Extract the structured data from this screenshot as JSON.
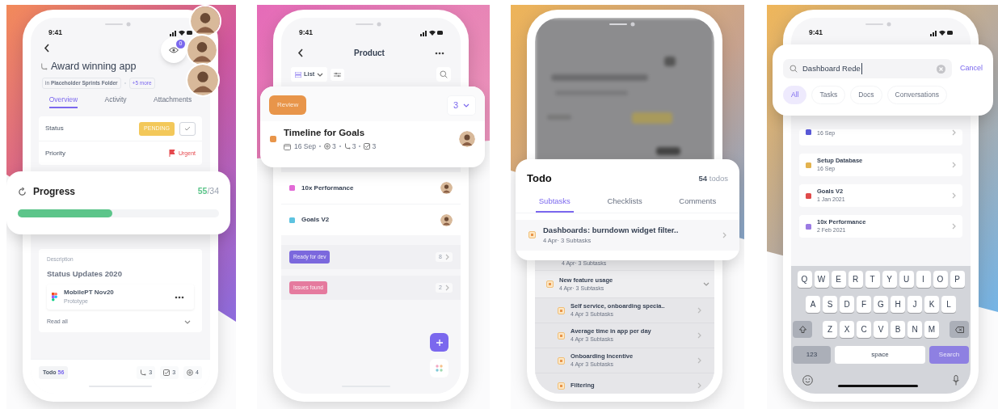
{
  "panels": [
    {
      "kind": "task_detail",
      "time": "9:41",
      "title": "Award winning app",
      "location": "in **Placeholder Sprints Folder**",
      "more": "+5 more",
      "watchers": "0",
      "tabs": [
        {
          "label": "Overview",
          "selected": true
        },
        {
          "label": "Activity",
          "selected": false
        },
        {
          "label": "Attachments",
          "selected": false
        }
      ],
      "fields": [
        {
          "kind": "status",
          "label": "Status",
          "value": "PENDING"
        },
        {
          "kind": "priority",
          "label": "Priority",
          "value": "Urgent"
        }
      ],
      "progress": {
        "title": "Progress",
        "done": "55",
        "total": "/34",
        "level": 0.47
      },
      "description": {
        "label": "Description",
        "title": "Status Updates 2020",
        "file": "MobilePT Nov20",
        "file_type": "Prototype",
        "link": "Read all"
      },
      "footer": {
        "status": "Todo",
        "count": "56",
        "counts": [
          {
            "kind": "subtasks",
            "value": "3"
          },
          {
            "kind": "checklists",
            "value": "3"
          },
          {
            "kind": "comments",
            "value": "4"
          }
        ]
      }
    },
    {
      "kind": "list",
      "time": "9:41",
      "title": "Product",
      "view": "List",
      "group": {
        "label": "Review",
        "count": "3",
        "color": "#e8954a"
      },
      "task": {
        "title": "Timeline for Goals",
        "color": "#e8954a",
        "date": "16 Sep",
        "meta": [
          {
            "kind": "comments",
            "value": "3"
          },
          {
            "kind": "subtasks",
            "value": "3"
          },
          {
            "kind": "checklists",
            "value": "3"
          }
        ]
      },
      "tasks": [
        {
          "title": "10x Performance",
          "color": "#e26ad6"
        },
        {
          "title": "Goals V2",
          "color": "#5ec3e0"
        }
      ],
      "groups": [
        {
          "label": "Ready for dev",
          "count": "8",
          "color": "#7b68dd"
        },
        {
          "label": "Issues found",
          "count": "2",
          "color": "#e57a9e"
        }
      ]
    },
    {
      "kind": "todo",
      "title": "Todo",
      "count": "54",
      "unit": "todos",
      "tabs": [
        {
          "label": "Subtasks",
          "selected": true
        },
        {
          "label": "Checklists",
          "selected": false
        },
        {
          "label": "Comments",
          "selected": false
        }
      ],
      "highlight": {
        "title": "Dashboards: burndown widget filter..",
        "subtitle": "4 Apr· 3 Subtasks"
      },
      "items": [
        {
          "subtitle": "4 Apr· 3 Subtasks"
        },
        {
          "title": "New feature usage",
          "subtitle": "4 Apr· 3 Subtasks",
          "expanded": true,
          "children": [
            {
              "title": "Self service, onboarding specia..",
              "subtitle": "4 Apr 3 Subtasks"
            },
            {
              "title": "Average time in app per day",
              "subtitle": "4 Apr 3 Subtasks"
            },
            {
              "title": "Onboarding Incentive",
              "subtitle": "4 Apr 3 Subtasks"
            },
            {
              "title": "Filtering"
            }
          ]
        }
      ]
    },
    {
      "kind": "search",
      "time": "9:41",
      "query": "Dashboard Rede",
      "cancel": "Cancel",
      "filters": [
        {
          "label": "All",
          "selected": true
        },
        {
          "label": "Tasks",
          "selected": false
        },
        {
          "label": "Docs",
          "selected": false
        },
        {
          "label": "Conversations",
          "selected": false
        }
      ],
      "results": [
        {
          "date": "16 Sep",
          "color": "#5a5ad8"
        },
        {
          "title": "Setup Database",
          "date": "16 Sep",
          "color": "#e3b34f"
        },
        {
          "title": "Goals V2",
          "date": "1 Jan 2021",
          "color": "#e04b4b"
        },
        {
          "title": "10x Performance",
          "date": "2 Feb 2021",
          "color": "#9b7be3"
        }
      ],
      "keyboard": {
        "rows": [
          [
            "Q",
            "W",
            "E",
            "R",
            "T",
            "Y",
            "U",
            "I",
            "O",
            "P"
          ],
          [
            "A",
            "S",
            "D",
            "F",
            "G",
            "H",
            "J",
            "K",
            "L"
          ],
          [
            "Z",
            "X",
            "C",
            "V",
            "B",
            "N",
            "M"
          ]
        ],
        "numbers": "123",
        "space": "space",
        "action": "Search"
      }
    }
  ]
}
